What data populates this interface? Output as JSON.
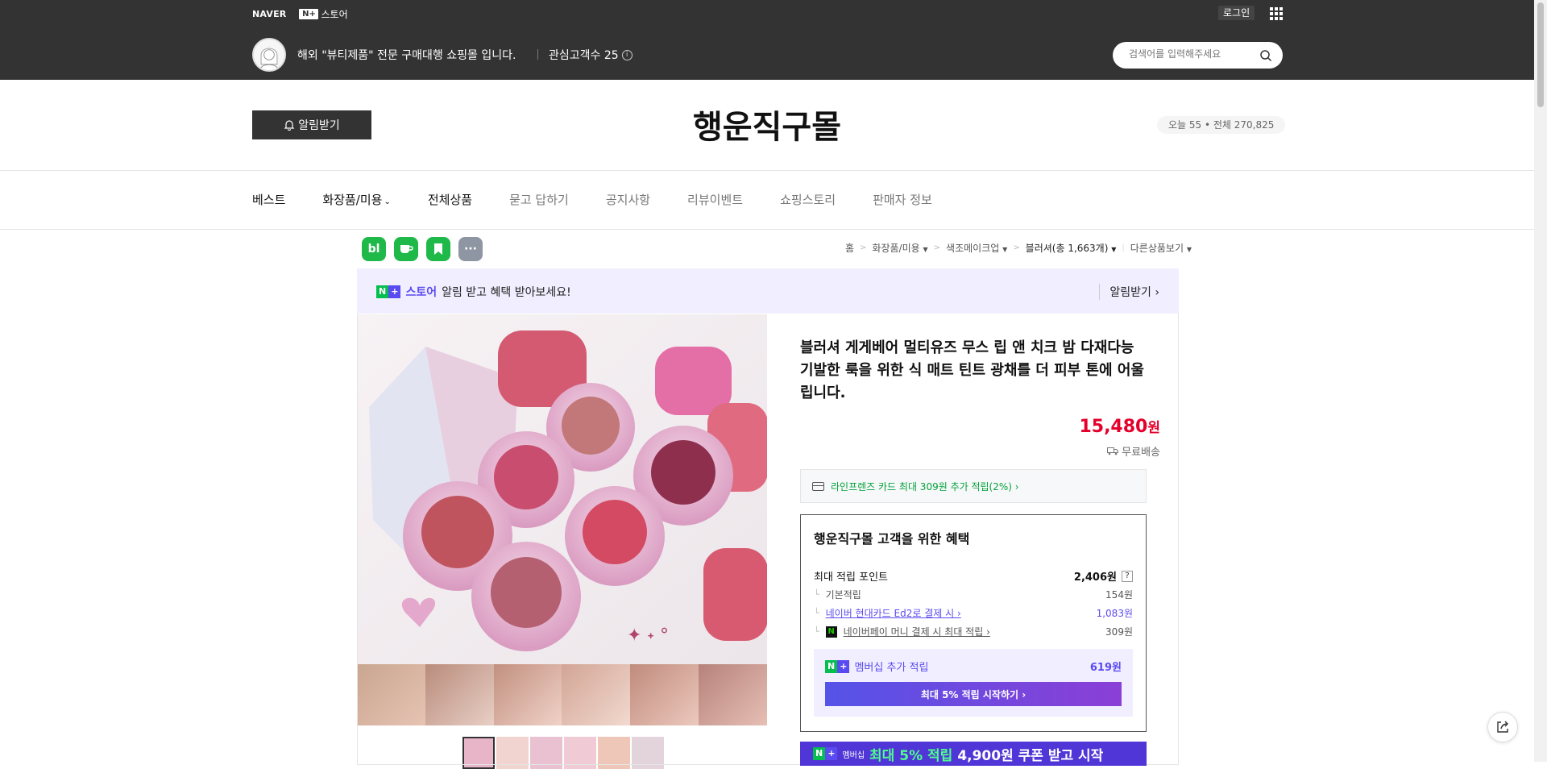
{
  "header": {
    "naver_logo": "NAVER",
    "nstore_plus": "N+",
    "nstore_label": "스토어",
    "login": "로그인",
    "store_description": "해외 \"뷰티제품\" 전문 구매대행 쇼핑몰 입니다.",
    "interest_label": "관심고객수 25",
    "search_placeholder": "검색어를 입력해주세요"
  },
  "store": {
    "notify_button": "알림받기",
    "title": "행운직구몰",
    "visits": "오늘 55 • 전체 270,825"
  },
  "nav": {
    "items": [
      {
        "label": "베스트"
      },
      {
        "label": "화장품/미용"
      },
      {
        "label": "전체상품"
      },
      {
        "label": "묻고 답하기"
      },
      {
        "label": "공지사항"
      },
      {
        "label": "리뷰이벤트"
      },
      {
        "label": "쇼핑스토리"
      },
      {
        "label": "판매자 정보"
      }
    ]
  },
  "share": {
    "icons": [
      "blog-icon",
      "cafe-icon",
      "bookmark-icon",
      "more-icon"
    ],
    "blog_label": "bl",
    "more_label": "···"
  },
  "breadcrumb": {
    "home": "홈",
    "cat1": "화장품/미용",
    "cat2": "색조메이크업",
    "cat3": "블러셔",
    "cat3_count": "(총 1,663개)",
    "other": "다른상품보기"
  },
  "notice": {
    "store_word": "스토어",
    "text": "알림 받고 혜택 받아보세요!",
    "action": "알림받기 ›"
  },
  "product": {
    "title": "블러셔 게게베어 멀티유즈 무스 립 앤 치크 밤 다재다능 기발한 룩을 위한 식 매트 틴트 광채를 더 피부 톤에 어울립니다.",
    "price": "15,480",
    "currency": "원",
    "shipping": "무료배송",
    "card_benefit": "라인프렌즈 카드 최대 309원 추가 적립(2%) ›"
  },
  "benefit": {
    "title": "행운직구몰 고객을 위한 혜택",
    "max_points_label": "최대 적립 포인트",
    "max_points_value": "2,406원",
    "q": "?",
    "basic_label": "기본적립",
    "basic_value": "154원",
    "card_label": "네이버 현대카드 Ed2로 결제 시 ›",
    "card_value": "1,083원",
    "npay_label": "네이버페이 머니 결제 시 최대 적립 ›",
    "npay_value": "309원",
    "member_label": "멤버십 추가 적립",
    "member_value": "619원",
    "member_button": "최대 5% 적립 시작하기 ›"
  },
  "promo": {
    "badge": "멤버십",
    "highlight": "최대 5% 적립",
    "text": "4,900원 쿠폰 받고 시작"
  },
  "colors": {
    "dark_header": "#333333",
    "price_red": "#e4002b",
    "naver_green": "#06bd50",
    "plus_purple": "#5a4bf0"
  }
}
